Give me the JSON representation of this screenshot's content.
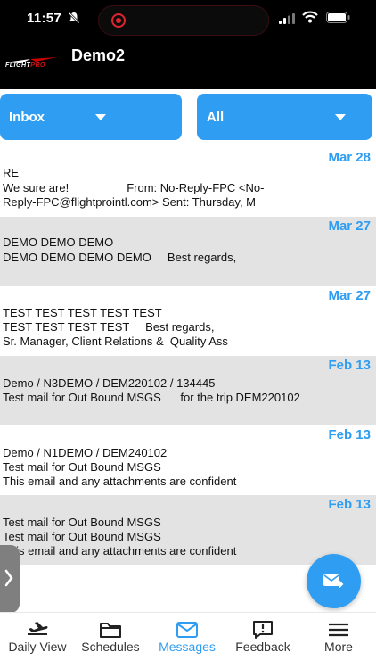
{
  "status_bar": {
    "time": "11:57"
  },
  "header": {
    "title": "Demo2",
    "logo_text_a": "FLIGHT",
    "logo_text_b": "PRO"
  },
  "filters": {
    "folder": "Inbox",
    "scope": "All"
  },
  "messages": [
    {
      "date": "Mar 28",
      "line1": "RE",
      "line2": "We sure are!                  From: No-Reply-FPC <No-",
      "line3": "Reply-FPC@flightprointl.com> Sent: Thursday, M"
    },
    {
      "date": "Mar 27",
      "line1": "DEMO DEMO DEMO",
      "line2": "DEMO DEMO DEMO DEMO     Best regards,",
      "line3": ""
    },
    {
      "date": "Mar 27",
      "line1": "TEST TEST TEST TEST TEST",
      "line2": "TEST TEST TEST TEST     Best regards,",
      "line3": "Sr. Manager, Client Relations &  Quality Ass"
    },
    {
      "date": "Feb 13",
      "line1": "Demo / N3DEMO / DEM220102 / 134445",
      "line2": "Test mail for Out Bound MSGS      for the trip DEM220102",
      "line3": ""
    },
    {
      "date": "Feb 13",
      "line1": "Demo / N1DEMO / DEM240102",
      "line2": "Test mail for Out Bound MSGS",
      "line3": "This email and any attachments are confident"
    },
    {
      "date": "Feb 13",
      "line1": "Test mail for Out Bound MSGS",
      "line2": "Test mail for Out Bound MSGS",
      "line3": "This email and any attachments are confident"
    }
  ],
  "tabs": [
    {
      "label": "Daily View",
      "icon": "airplane-icon"
    },
    {
      "label": "Schedules",
      "icon": "folder-icon"
    },
    {
      "label": "Messages",
      "icon": "mail-icon"
    },
    {
      "label": "Feedback",
      "icon": "feedback-icon"
    },
    {
      "label": "More",
      "icon": "menu-icon"
    }
  ],
  "colors": {
    "accent": "#2f9df2",
    "header_bg": "#000000",
    "shaded_row": "#e3e3e3"
  }
}
